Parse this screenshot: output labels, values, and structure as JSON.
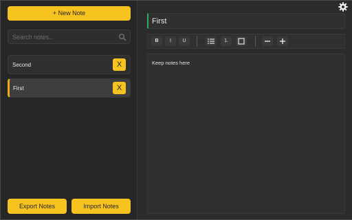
{
  "sidebar": {
    "new_note_label": "+ New Note",
    "search_placeholder": "Search notes...",
    "notes": [
      {
        "title": "Second",
        "delete_label": "X",
        "active": false
      },
      {
        "title": "First",
        "delete_label": "X",
        "active": true
      }
    ],
    "export_label": "Export Notes",
    "import_label": "Import Notes"
  },
  "editor": {
    "title_value": "First",
    "toolbar": {
      "bold": "B",
      "italic": "I",
      "underline": "U",
      "bullet_list_icon": "bullet-list-icon",
      "numbered_list": "1.",
      "checkbox_icon": "checkbox-icon",
      "decrease_icon": "minus-icon",
      "increase_icon": "plus-icon"
    },
    "content": "Keep notes here"
  },
  "settings_icon": "gear-icon",
  "colors": {
    "accent": "#f7c31f",
    "active_note_border": "#f0a91b",
    "title_border": "#2fae62",
    "background": "#2b2b2b"
  }
}
